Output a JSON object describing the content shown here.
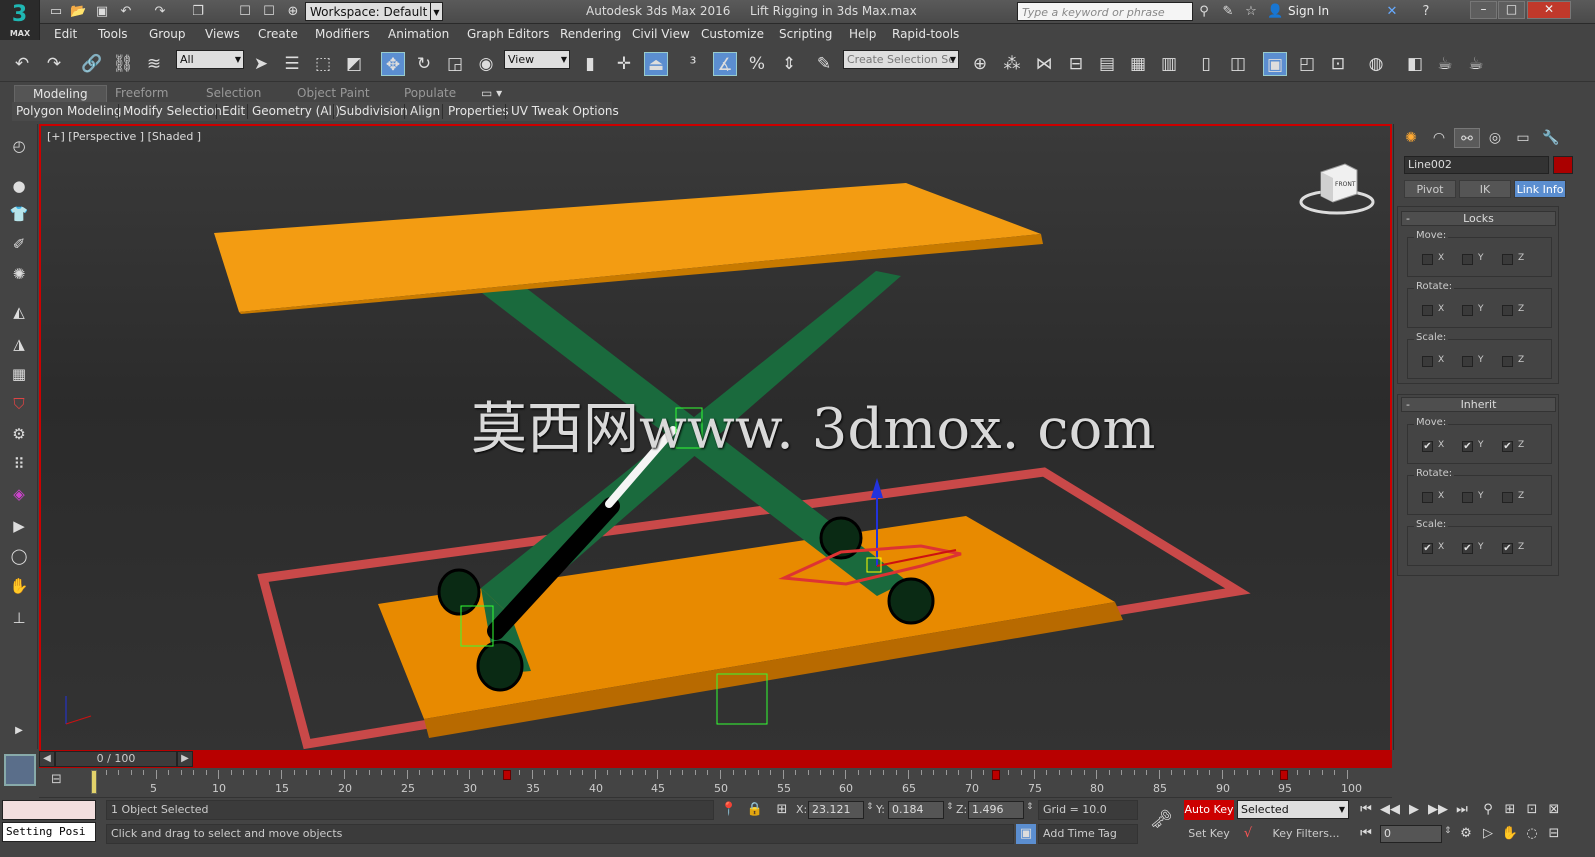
{
  "title_bar": {
    "workspace": "Workspace: Default",
    "app_title": "Autodesk 3ds Max 2016",
    "file_name": "Lift Rigging in 3ds Max.max",
    "search_placeholder": "Type a keyword or phrase",
    "sign_in": "Sign In",
    "logo_text": "MAX"
  },
  "menu": [
    "Edit",
    "Tools",
    "Group",
    "Views",
    "Create",
    "Modifiers",
    "Animation",
    "Graph Editors",
    "Rendering",
    "Civil View",
    "Customize",
    "Scripting",
    "Help",
    "Rapid-tools"
  ],
  "toolbar": {
    "selection_filter": "All",
    "reference_coord": "View",
    "named_selection": "Create Selection Se"
  },
  "ribbon": {
    "tabs": [
      "Modeling",
      "Freeform",
      "Selection",
      "Object Paint",
      "Populate"
    ],
    "selected_tab": "Modeling",
    "sub_items": [
      "Polygon Modeling",
      "Modify Selection",
      "Edit",
      "Geometry (All)",
      "Subdivision",
      "Align",
      "Properties",
      "UV Tweak Options"
    ]
  },
  "viewport": {
    "label": "[+] [Perspective ] [Shaded ]",
    "watermark": "莫西网www. 3dmox. com",
    "viewcube_face": "FRONT"
  },
  "command_panel": {
    "object_name": "Line002",
    "object_color": "#aa0000",
    "sub_tabs": [
      "Pivot",
      "IK",
      "Link Info"
    ],
    "selected_sub_tab": "Link Info",
    "locks": {
      "title": "Locks",
      "groups": [
        {
          "label": "Move:",
          "x": false,
          "y": false,
          "z": false
        },
        {
          "label": "Rotate:",
          "x": false,
          "y": false,
          "z": false
        },
        {
          "label": "Scale:",
          "x": false,
          "y": false,
          "z": false
        }
      ]
    },
    "inherit": {
      "title": "Inherit",
      "groups": [
        {
          "label": "Move:",
          "x": true,
          "y": true,
          "z": true
        },
        {
          "label": "Rotate:",
          "x": false,
          "y": false,
          "z": false
        },
        {
          "label": "Scale:",
          "x": true,
          "y": true,
          "z": true
        }
      ]
    },
    "axis_labels": [
      "X",
      "Y",
      "Z"
    ]
  },
  "timeline": {
    "frame_display": "0 / 100",
    "ticks": [
      5,
      10,
      15,
      20,
      25,
      30,
      35,
      40,
      45,
      50,
      55,
      60,
      65,
      70,
      75,
      80,
      85,
      90,
      95,
      100
    ],
    "keys": [
      33,
      72,
      95
    ]
  },
  "status": {
    "maxscript_text": "Setting Posi",
    "selection_count": "1 Object Selected",
    "prompt": "Click and drag to select and move objects",
    "x_label": "X:",
    "x_value": "23.121",
    "y_label": "Y:",
    "y_value": "0.184",
    "z_label": "Z:",
    "z_value": "1.496",
    "grid": "Grid = 10.0",
    "add_time_tag": "Add Time Tag",
    "auto_key": "Auto Key",
    "set_key": "Set Key",
    "key_mode_select": "Selected",
    "key_filters": "Key Filters...",
    "current_frame": "0"
  }
}
